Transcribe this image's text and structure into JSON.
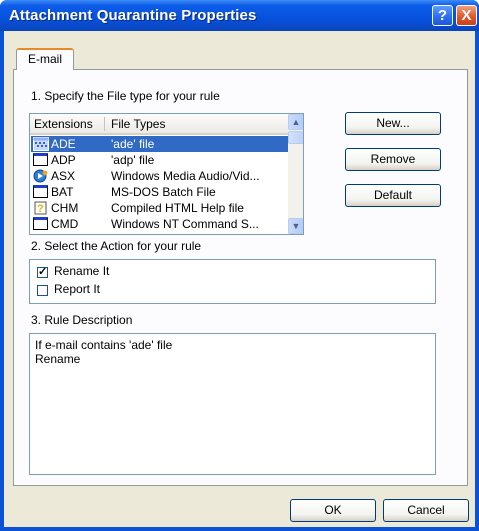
{
  "window": {
    "title": "Attachment Quarantine Properties",
    "help_glyph": "?",
    "close_glyph": "X",
    "colors": {
      "titlebar": "#0653df",
      "face": "#ece9d8",
      "selection": "#316ac5"
    }
  },
  "tabs": [
    {
      "label": "E-mail",
      "active": true
    }
  ],
  "section1": {
    "label": "1. Specify the File type for your rule",
    "columns": [
      "Extensions",
      "File Types"
    ],
    "rows": [
      {
        "ext": "ADE",
        "type": "'ade' file",
        "icon": "document-icon",
        "selected": true
      },
      {
        "ext": "ADP",
        "type": "'adp' file",
        "icon": "document-icon",
        "selected": false
      },
      {
        "ext": "ASX",
        "type": "Windows Media Audio/Vid...",
        "icon": "media-player-icon",
        "selected": false
      },
      {
        "ext": "BAT",
        "type": "MS-DOS Batch File",
        "icon": "document-icon",
        "selected": false
      },
      {
        "ext": "CHM",
        "type": "Compiled HTML Help file",
        "icon": "help-file-icon",
        "selected": false
      },
      {
        "ext": "CMD",
        "type": "Windows NT Command S...",
        "icon": "document-icon",
        "selected": false
      }
    ]
  },
  "buttons": {
    "new": "New...",
    "remove": "Remove",
    "default": "Default",
    "ok": "OK",
    "cancel": "Cancel"
  },
  "section2": {
    "label": "2. Select the Action for your rule",
    "actions": [
      {
        "label": "Rename It",
        "checked": true
      },
      {
        "label": "Report It",
        "checked": false
      }
    ]
  },
  "section3": {
    "label": "3. Rule Description",
    "lines": [
      "If e-mail contains 'ade' file",
      "Rename"
    ]
  }
}
